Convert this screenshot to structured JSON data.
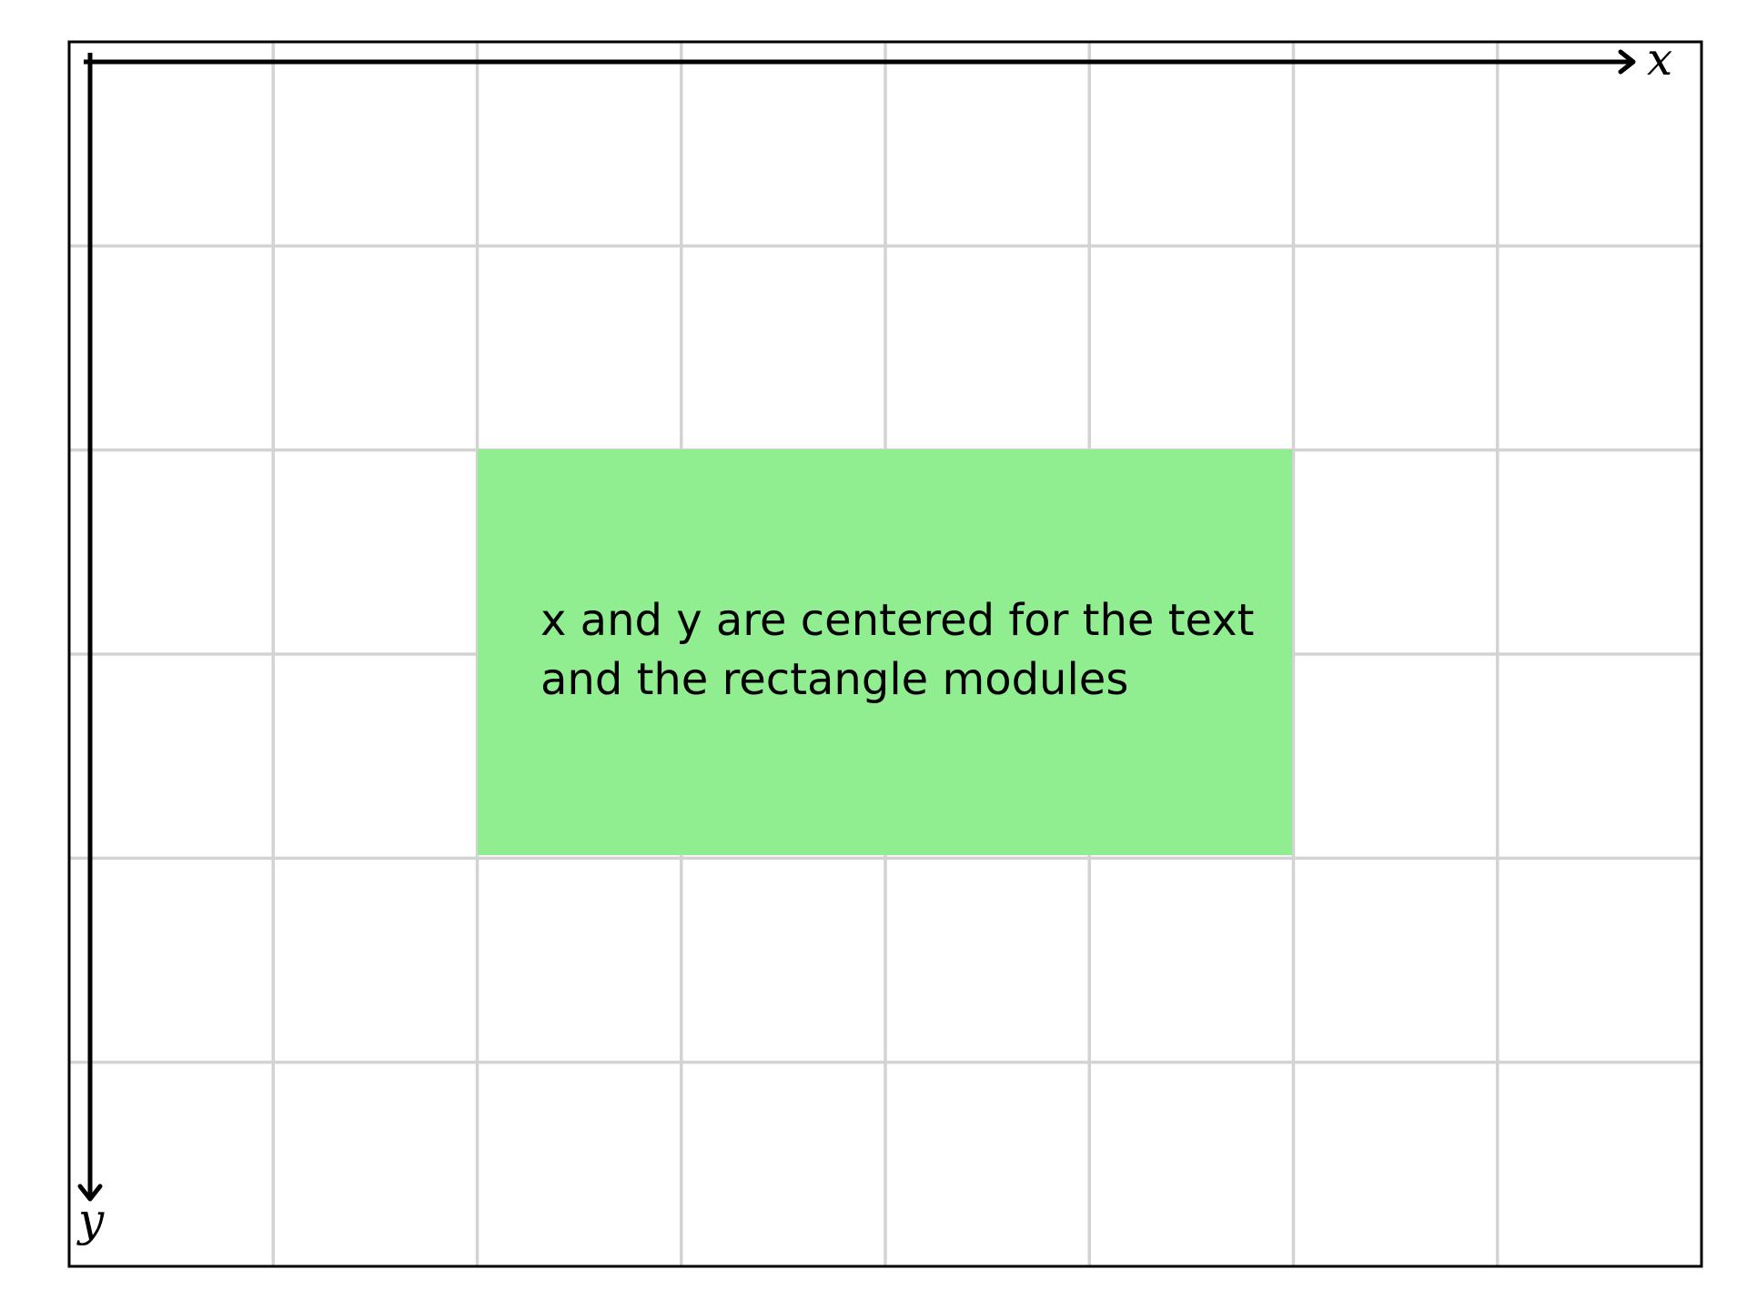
{
  "diagram": {
    "axes": {
      "x_label": "x",
      "y_label": "y"
    },
    "grid": {
      "columns": 8,
      "rows": 6,
      "visible": true,
      "line_color": "#d3d3d3"
    },
    "rectangle": {
      "fill_color": "#90ee90",
      "text_lines": [
        "x and y are centered for the text",
        "and the rectangle modules"
      ]
    }
  }
}
